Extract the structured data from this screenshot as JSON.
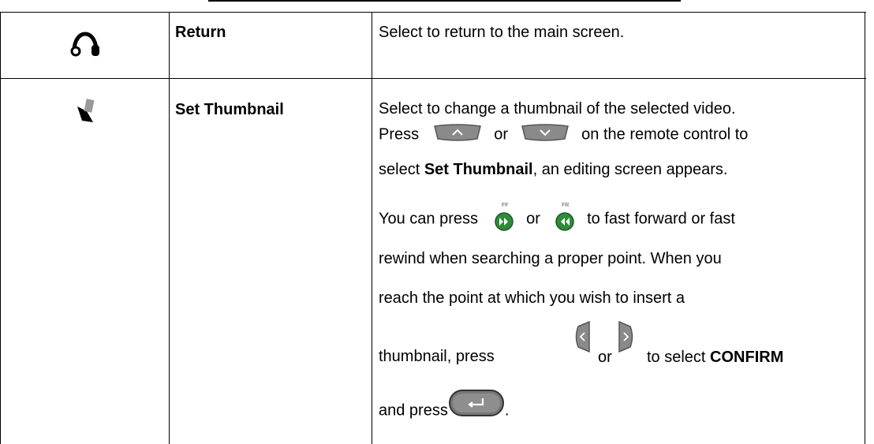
{
  "rows": [
    {
      "icon": "return-icon",
      "name": "Return",
      "desc": "Select to return to the main screen."
    },
    {
      "icon": "set-thumbnail-icon",
      "name": "Set Thumbnail",
      "lines": {
        "l1": "Select to change a thumbnail of the selected video.",
        "l2_a": "Press",
        "l2_or": "or",
        "l2_b": "on the remote control to",
        "l3_a": "select",
        "l3_bold": "Set Thumbnail",
        "l3_b": ", an editing screen appears.",
        "l4_a": "You can press",
        "l4_or": "or",
        "l4_b": "to fast forward or fast",
        "l5": "rewind when searching a proper point. When you",
        "l6": "reach the point at which you wish to insert a",
        "l7_a": "thumbnail, press",
        "l7_or": "or",
        "l7_b": "to select",
        "l7_bold": "CONFIRM",
        "l8_a": "and press",
        "l8_b": "."
      },
      "buttons": {
        "ff_label": "FF",
        "fr_label": "FR"
      }
    }
  ],
  "colors": {
    "border": "#000000",
    "button_gray": "#8a8a8a",
    "button_green": "#2e8b3a"
  }
}
